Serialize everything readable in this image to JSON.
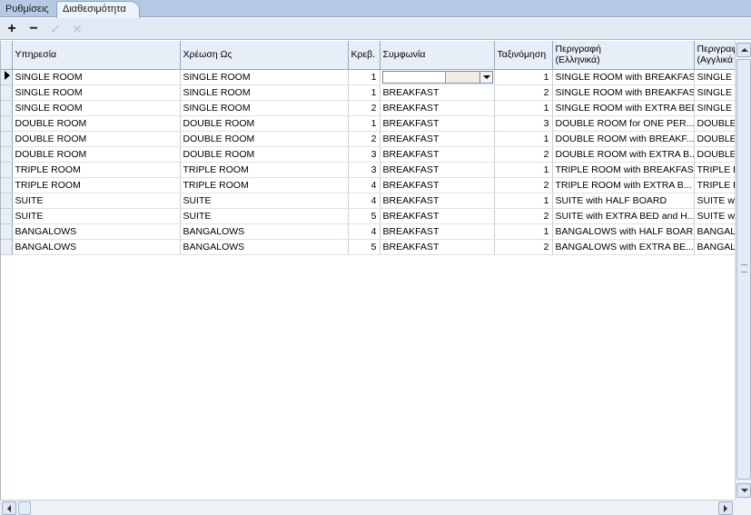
{
  "tabs": [
    {
      "label": "Ρυθμίσεις",
      "active": false
    },
    {
      "label": "Διαθεσιμότητα",
      "active": true
    }
  ],
  "toolbar": {
    "add": "+",
    "remove": "−",
    "confirm": "✓",
    "cancel": "✕"
  },
  "grid": {
    "columns": [
      "Υπηρεσία",
      "Χρέωση Ως",
      "Κρεβ.",
      "Συμφωνία",
      "Ταξινόμηση",
      "Περιγραφή (Ελληνικά)",
      "Περιγραφή (Αγγλικά)"
    ],
    "headers": {
      "service": "Υπηρεσία",
      "charge_as": "Χρέωση Ως",
      "beds": "Κρεβ.",
      "agreement": "Συμφωνία",
      "sort": "Ταξινόμηση",
      "desc_gr_1": "Περιγραφή",
      "desc_gr_2": "(Ελληνικά)",
      "desc_en_1": "Περιγραφ",
      "desc_en_2": "(Αγγλικά"
    },
    "rows": [
      {
        "service": "SINGLE ROOM",
        "charge_as": "SINGLE ROOM",
        "beds": "1",
        "agreement": "",
        "sort": "1",
        "desc_gr": "SINGLE ROOM with BREAKFAST",
        "desc_en": "SINGLE R"
      },
      {
        "service": "SINGLE ROOM",
        "charge_as": "SINGLE ROOM",
        "beds": "1",
        "agreement": "BREAKFAST",
        "sort": "2",
        "desc_gr": "SINGLE ROOM with BREAKFAST",
        "desc_en": "SINGLE R"
      },
      {
        "service": "SINGLE ROOM",
        "charge_as": "SINGLE ROOM",
        "beds": "2",
        "agreement": "BREAKFAST",
        "sort": "1",
        "desc_gr": "SINGLE ROOM with EXTRA BED",
        "desc_en": "SINGLE R"
      },
      {
        "service": "DOUBLE ROOM",
        "charge_as": "DOUBLE ROOM",
        "beds": "1",
        "agreement": "BREAKFAST",
        "sort": "3",
        "desc_gr": "DOUBLE ROOM for ONE PER...",
        "desc_en": "DOUBLE R"
      },
      {
        "service": "DOUBLE ROOM",
        "charge_as": "DOUBLE ROOM",
        "beds": "2",
        "agreement": "BREAKFAST",
        "sort": "1",
        "desc_gr": "DOUBLE ROOM with BREAKF...",
        "desc_en": "DOUBLE R"
      },
      {
        "service": "DOUBLE ROOM",
        "charge_as": "DOUBLE ROOM",
        "beds": "3",
        "agreement": "BREAKFAST",
        "sort": "2",
        "desc_gr": "DOUBLE ROOM with EXTRA B...",
        "desc_en": "DOUBLE R"
      },
      {
        "service": "TRIPLE ROOM",
        "charge_as": "TRIPLE ROOM",
        "beds": "3",
        "agreement": "BREAKFAST",
        "sort": "1",
        "desc_gr": "TRIPLE ROOM with BREAKFAST",
        "desc_en": "TRIPLE R"
      },
      {
        "service": "TRIPLE ROOM",
        "charge_as": "TRIPLE ROOM",
        "beds": "4",
        "agreement": "BREAKFAST",
        "sort": "2",
        "desc_gr": "TRIPLE ROOM with EXTRA B...",
        "desc_en": "TRIPLE R"
      },
      {
        "service": "SUITE",
        "charge_as": "SUITE",
        "beds": "4",
        "agreement": "BREAKFAST",
        "sort": "1",
        "desc_gr": "SUITE with HALF BOARD",
        "desc_en": "SUITE wit"
      },
      {
        "service": "SUITE",
        "charge_as": "SUITE",
        "beds": "5",
        "agreement": "BREAKFAST",
        "sort": "2",
        "desc_gr": "SUITE with EXTRA BED and H...",
        "desc_en": "SUITE wit"
      },
      {
        "service": "BANGALOWS",
        "charge_as": "BANGALOWS",
        "beds": "4",
        "agreement": "BREAKFAST",
        "sort": "1",
        "desc_gr": "BANGALOWS with HALF BOARD",
        "desc_en": "BANGALO"
      },
      {
        "service": "BANGALOWS",
        "charge_as": "BANGALOWS",
        "beds": "5",
        "agreement": "BREAKFAST",
        "sort": "2",
        "desc_gr": "BANGALOWS with EXTRA BE...",
        "desc_en": "BANGALO"
      }
    ]
  },
  "icons": {
    "add": "plus-icon",
    "remove": "minus-icon",
    "confirm": "check-icon",
    "cancel": "x-icon",
    "row_indicator": "arrow-right-icon",
    "dropdown": "chevron-down-icon"
  },
  "colors": {
    "tabstrip": "#b6c9e4",
    "toolbar": "#e1e9f5",
    "header": "#e8eef8",
    "disabled_icon": "#b8c1cc"
  }
}
